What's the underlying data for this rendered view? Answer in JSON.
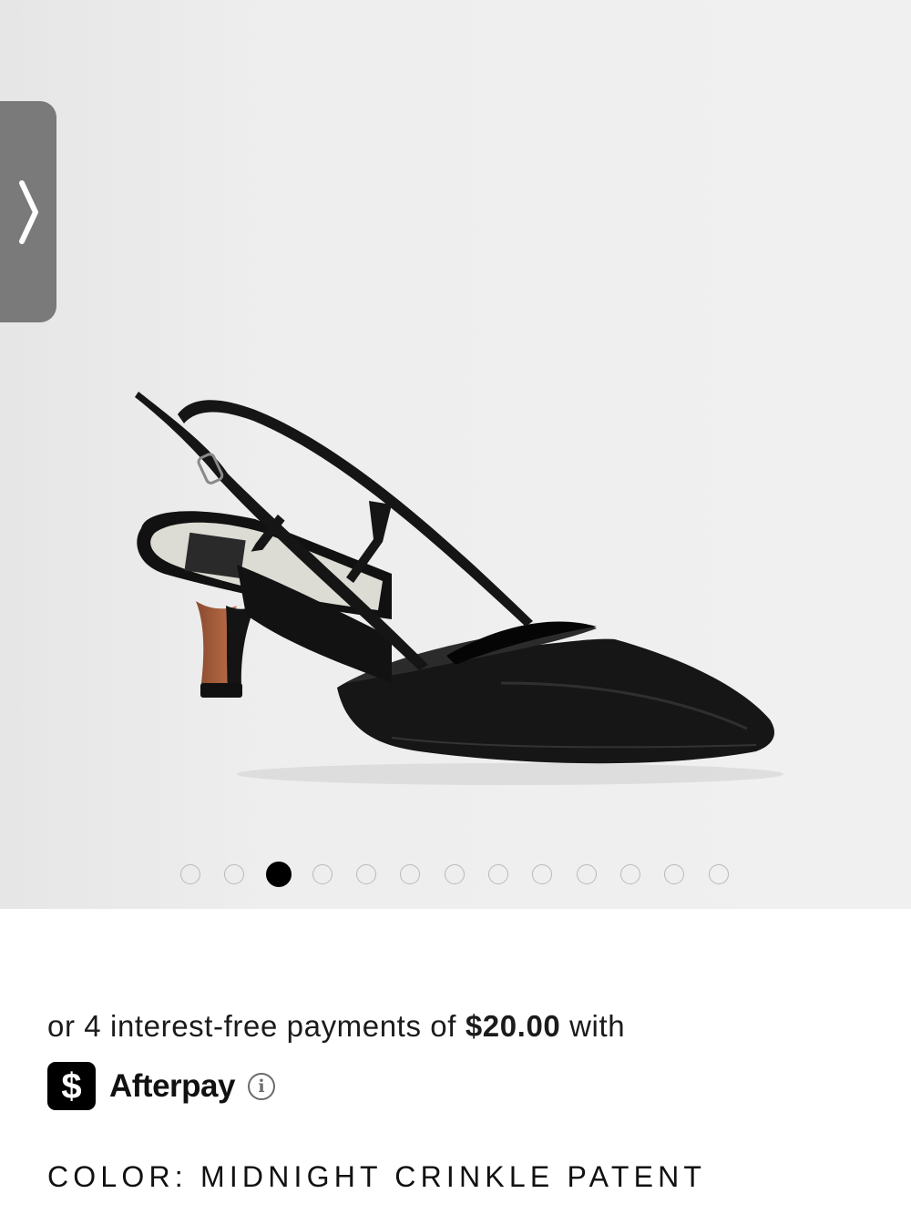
{
  "gallery": {
    "next_tab_icon": "chevron-right-icon",
    "slide_count": 13,
    "active_slide": 3
  },
  "afterpay": {
    "prefix": "or 4 interest-free payments of ",
    "amount": "$20.00",
    "suffix": " with",
    "brand": "Afterpay",
    "logo_glyph": "$",
    "info_icon": "info-icon",
    "info_glyph": "i"
  },
  "product": {
    "color_label": "COLOR: MIDNIGHT CRINKLE PATENT"
  },
  "colors": {
    "tab_bg": "#7a7a7a",
    "dot_active": "#000000",
    "dot_inactive": "#b9b9b9"
  }
}
